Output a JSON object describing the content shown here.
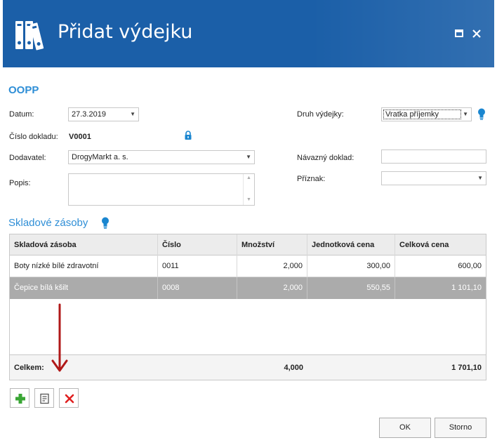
{
  "window": {
    "title": "Přidat výdejku"
  },
  "form": {
    "section_title": "OOPP",
    "datum_label": "Datum:",
    "datum_value": "27.3.2019",
    "cislo_label": "Číslo dokladu:",
    "cislo_value": "V0001",
    "dodavatel_label": "Dodavatel:",
    "dodavatel_value": "DrogyMarkt a. s.",
    "popis_label": "Popis:",
    "popis_value": "",
    "druh_label": "Druh výdejky:",
    "druh_value": "Vratka příjemky",
    "navazny_label": "Návazný doklad:",
    "navazny_value": "",
    "priznak_label": "Příznak:",
    "priznak_value": ""
  },
  "stock": {
    "section_title": "Skladové zásoby",
    "columns": [
      "Skladová zásoba",
      "Číslo",
      "Množství",
      "Jednotková cena",
      "Celková cena"
    ],
    "rows": [
      {
        "name": "Boty nízké bílé zdravotní",
        "number": "0011",
        "qty": "2,000",
        "unit_price": "300,00",
        "total": "600,00"
      },
      {
        "name": "Čepice bílá kšilt",
        "number": "0008",
        "qty": "2,000",
        "unit_price": "550,55",
        "total": "1 101,10"
      }
    ],
    "footer": {
      "label": "Celkem:",
      "qty": "4,000",
      "total": "1 701,10"
    }
  },
  "toolbar": {
    "add_icon": "plus-icon",
    "edit_icon": "edit-icon",
    "delete_icon": "delete-icon"
  },
  "buttons": {
    "ok": "OK",
    "cancel": "Storno"
  },
  "colors": {
    "titlebar": "#1b5fa8",
    "accent": "#2e8ed6",
    "selected_row": "#ababab",
    "add_green": "#3aa635",
    "delete_red": "#e02020",
    "annotation_arrow": "#b01818"
  }
}
